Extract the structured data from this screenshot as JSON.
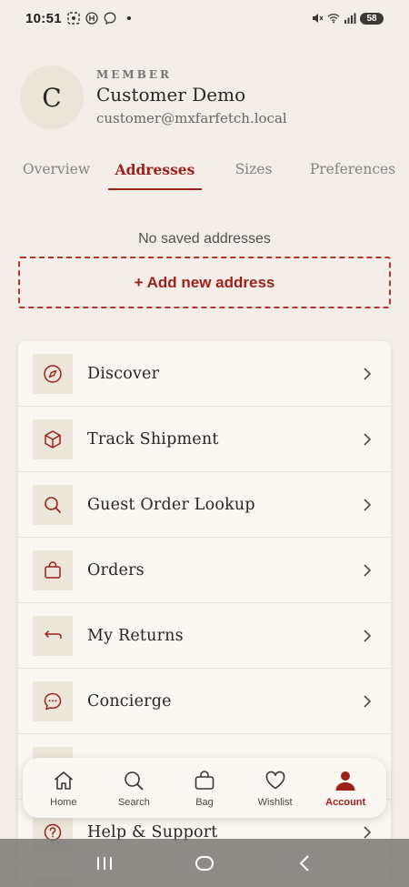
{
  "status_bar": {
    "time": "10:51",
    "battery": "58",
    "icons_left": [
      "focus-icon",
      "h-badge-icon",
      "messenger-icon"
    ],
    "icons_right": [
      "mute-icon",
      "wifi-icon",
      "signal-icon",
      "battery-icon"
    ]
  },
  "profile": {
    "initial": "C",
    "role": "MEMBER",
    "name": "Customer Demo",
    "email": "customer@mxfarfetch.local"
  },
  "tabs": [
    {
      "label": "Overview",
      "active": false
    },
    {
      "label": "Addresses",
      "active": true
    },
    {
      "label": "Sizes",
      "active": false
    },
    {
      "label": "Preferences",
      "active": false
    }
  ],
  "addresses": {
    "empty_text": "No saved addresses",
    "add_label": "+ Add new address"
  },
  "menu": {
    "items": [
      {
        "label": "Discover",
        "icon": "compass-icon"
      },
      {
        "label": "Track Shipment",
        "icon": "box-icon"
      },
      {
        "label": "Guest Order Lookup",
        "icon": "search-icon"
      },
      {
        "label": "Orders",
        "icon": "bag-icon"
      },
      {
        "label": "My Returns",
        "icon": "return-arrow-icon"
      },
      {
        "label": "Concierge",
        "icon": "chat-icon"
      },
      {
        "label": "",
        "icon": "hidden-icon"
      },
      {
        "label": "Help & Support",
        "icon": "help-icon"
      }
    ]
  },
  "bottom_nav": {
    "items": [
      {
        "label": "Home",
        "icon": "home-icon",
        "active": false
      },
      {
        "label": "Search",
        "icon": "search-icon",
        "active": false
      },
      {
        "label": "Bag",
        "icon": "bag-icon",
        "active": false
      },
      {
        "label": "Wishlist",
        "icon": "heart-icon",
        "active": false
      },
      {
        "label": "Account",
        "icon": "person-icon",
        "active": true
      }
    ]
  },
  "colors": {
    "accent": "#9c1f1a",
    "background": "#f3eee7",
    "card": "#faf7f2"
  }
}
